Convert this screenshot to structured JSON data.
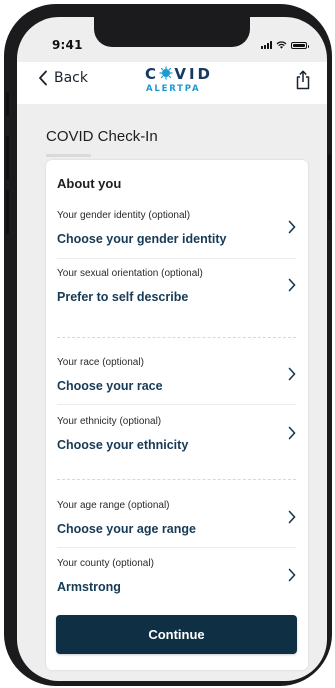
{
  "status_bar": {
    "time": "9:41"
  },
  "nav": {
    "back_label": "Back",
    "logo": {
      "top": "COVID",
      "bottom": "ALERTPA",
      "virus_color": "#1d9bd0",
      "top_color": "#173a63",
      "bottom_color": "#1d9bd0"
    }
  },
  "page": {
    "title": "COVID Check-In"
  },
  "card": {
    "heading": "About you",
    "rows": [
      {
        "label": "Your gender identity (optional)",
        "value": "Choose your gender identity"
      },
      {
        "label": "Your sexual orientation (optional)",
        "value": "Prefer to self describe"
      },
      {
        "label": "Your race (optional)",
        "value": "Choose your race"
      },
      {
        "label": "Your ethnicity (optional)",
        "value": "Choose your ethnicity"
      },
      {
        "label": "Your age range (optional)",
        "value": "Choose your age range"
      },
      {
        "label": "Your county (optional)",
        "value": "Armstrong"
      }
    ],
    "continue_label": "Continue"
  },
  "icons": {
    "back": "chevron-left-icon",
    "share": "share-icon",
    "row_chevron": "chevron-right-icon"
  },
  "colors": {
    "primary_button": "#0f2f44",
    "value_text": "#173a55",
    "brand_blue": "#1d9bd0"
  }
}
